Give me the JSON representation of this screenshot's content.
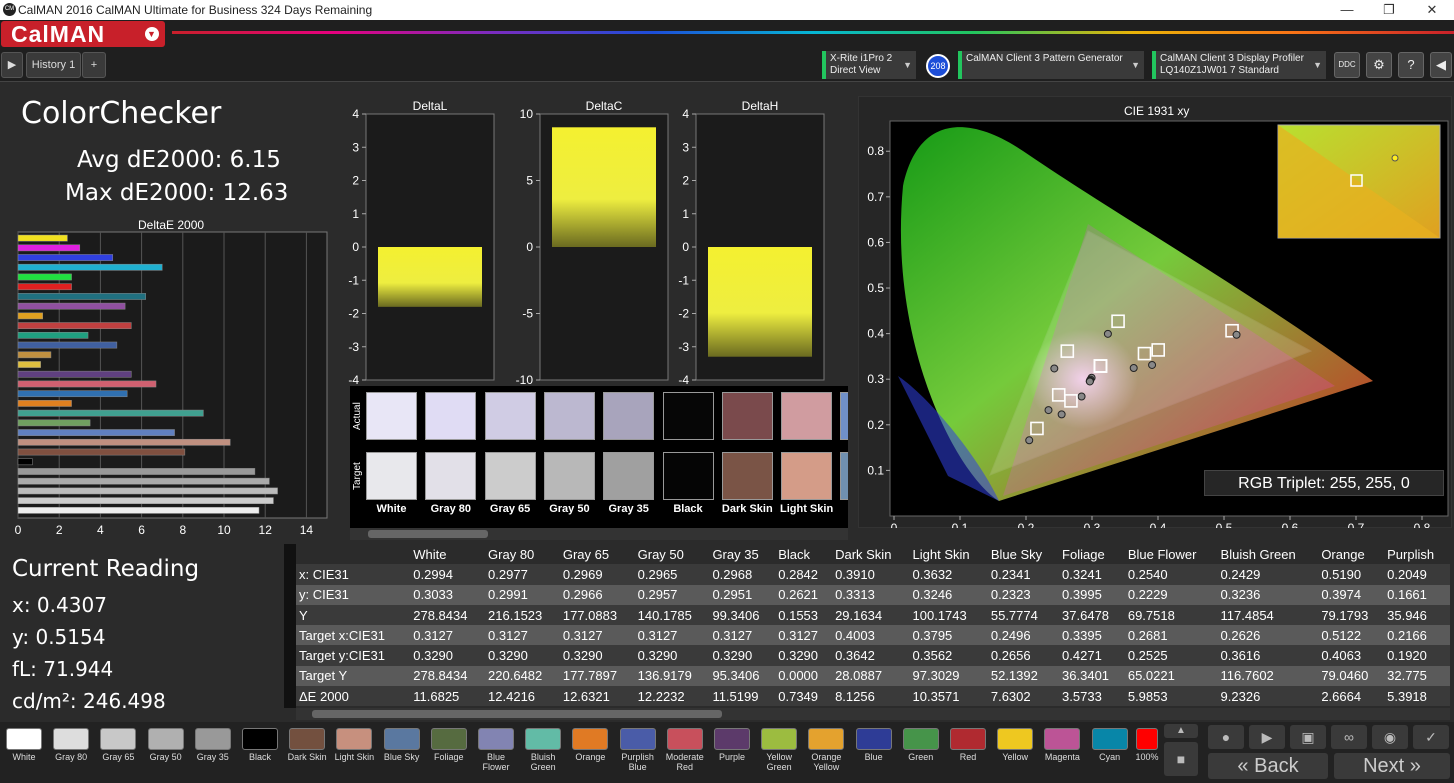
{
  "window": {
    "title": "CalMAN 2016 CalMAN Ultimate for Business 324 Days Remaining",
    "logo": "CM"
  },
  "brand": {
    "name": "CalMAN"
  },
  "toolbar": {
    "history_tab": "History 1",
    "add_tab": "+",
    "meter": {
      "line1": "X-Rite i1Pro 2",
      "line2": "Direct View",
      "badge": "208"
    },
    "pattern": {
      "line1": "CalMAN Client 3 Pattern Generator"
    },
    "display": {
      "line1": "CalMAN Client 3 Display Profiler",
      "line2": "LQ140Z1JW01 7 Standard"
    }
  },
  "colorchecker": {
    "title": "ColorChecker",
    "avg": "Avg dE2000: 6.15",
    "max": "Max dE2000: 12.63",
    "deltae_title": "DeltaE 2000"
  },
  "deltae_chart": {
    "xticks": [
      "0",
      "2",
      "4",
      "6",
      "8",
      "10",
      "12",
      "14"
    ],
    "bars": [
      {
        "v": 2.4,
        "c": "#f0e020"
      },
      {
        "v": 3.0,
        "c": "#e020e0"
      },
      {
        "v": 4.6,
        "c": "#3040e0"
      },
      {
        "v": 7.0,
        "c": "#20b0d0"
      },
      {
        "v": 2.6,
        "c": "#20e040"
      },
      {
        "v": 2.6,
        "c": "#e02020"
      },
      {
        "v": 6.2,
        "c": "#207080"
      },
      {
        "v": 5.2,
        "c": "#9050a0"
      },
      {
        "v": 1.2,
        "c": "#e0a020"
      },
      {
        "v": 5.5,
        "c": "#c04040"
      },
      {
        "v": 3.4,
        "c": "#20a080"
      },
      {
        "v": 4.8,
        "c": "#4060a0"
      },
      {
        "v": 1.6,
        "c": "#c09040"
      },
      {
        "v": 1.1,
        "c": "#e0c040"
      },
      {
        "v": 5.5,
        "c": "#604080"
      },
      {
        "v": 6.7,
        "c": "#d06070"
      },
      {
        "v": 5.3,
        "c": "#3070b0"
      },
      {
        "v": 2.6,
        "c": "#e08020"
      },
      {
        "v": 9.0,
        "c": "#40a090"
      },
      {
        "v": 3.5,
        "c": "#70a060"
      },
      {
        "v": 7.6,
        "c": "#6080c0"
      },
      {
        "v": 10.3,
        "c": "#c09080"
      },
      {
        "v": 8.1,
        "c": "#805040"
      },
      {
        "v": 0.7,
        "c": "#000000"
      },
      {
        "v": 11.5,
        "c": "#999999"
      },
      {
        "v": 12.2,
        "c": "#aaaaaa"
      },
      {
        "v": 12.6,
        "c": "#bbbbbb"
      },
      {
        "v": 12.4,
        "c": "#cccccc"
      },
      {
        "v": 11.7,
        "c": "#eeeeee"
      }
    ]
  },
  "delta_charts": [
    {
      "title": "DeltaL",
      "ticks": [
        "4",
        "3",
        "2",
        "1",
        "0",
        "-1",
        "-2",
        "-3",
        "-4"
      ],
      "value": -1.8,
      "range": [
        -4,
        4
      ]
    },
    {
      "title": "DeltaC",
      "ticks": [
        "10",
        "5",
        "0",
        "-5",
        "-10"
      ],
      "value": 9.0,
      "range": [
        -10,
        10
      ]
    },
    {
      "title": "DeltaH",
      "ticks": [
        "4",
        "3",
        "2",
        "1",
        "0",
        "-1",
        "-2",
        "-3",
        "-4"
      ],
      "value": -3.3,
      "range": [
        -4,
        4
      ]
    }
  ],
  "swatch_strip": {
    "actual_label": "Actual",
    "target_label": "Target",
    "items": [
      {
        "name": "White",
        "actual": "#e8e6f6",
        "target": "#e8e8ec"
      },
      {
        "name": "Gray 80",
        "actual": "#e0dcf4",
        "target": "#e2e0e8"
      },
      {
        "name": "Gray 65",
        "actual": "#d0cce4",
        "target": "#cccccc"
      },
      {
        "name": "Gray 50",
        "actual": "#bcb8d0",
        "target": "#b8b8b8"
      },
      {
        "name": "Gray 35",
        "actual": "#a8a4bc",
        "target": "#a0a0a0"
      },
      {
        "name": "Black",
        "actual": "#060606",
        "target": "#050505"
      },
      {
        "name": "Dark Skin",
        "actual": "#7a4a4c",
        "target": "#7a5446"
      },
      {
        "name": "Light Skin",
        "actual": "#d09ca0",
        "target": "#d49c88"
      },
      {
        "name": "B",
        "actual": "#7090c8",
        "target": "#7090b0"
      }
    ]
  },
  "cie": {
    "title": "CIE 1931 xy",
    "xticks": [
      "0",
      "0.1",
      "0.2",
      "0.3",
      "0.4",
      "0.5",
      "0.6",
      "0.7",
      "0.8"
    ],
    "yticks": [
      "0.8",
      "0.7",
      "0.6",
      "0.5",
      "0.4",
      "0.3",
      "0.2",
      "0.1"
    ],
    "rgb_triplet": "RGB Triplet: 255, 255, 0"
  },
  "current": {
    "title": "Current Reading",
    "x": "x: 0.4307",
    "y": "y: 0.5154",
    "fl": "fL: 71.944",
    "cdm": "cd/m²: 246.498"
  },
  "table": {
    "columns": [
      "",
      "White",
      "Gray 80",
      "Gray 65",
      "Gray 50",
      "Gray 35",
      "Black",
      "Dark Skin",
      "Light Skin",
      "Blue Sky",
      "Foliage",
      "Blue Flower",
      "Bluish Green",
      "Orange",
      "Purplish"
    ],
    "rows": [
      [
        "x: CIE31",
        "0.2994",
        "0.2977",
        "0.2969",
        "0.2965",
        "0.2968",
        "0.2842",
        "0.3910",
        "0.3632",
        "0.2341",
        "0.3241",
        "0.2540",
        "0.2429",
        "0.5190",
        "0.2049"
      ],
      [
        "y: CIE31",
        "0.3033",
        "0.2991",
        "0.2966",
        "0.2957",
        "0.2951",
        "0.2621",
        "0.3313",
        "0.3246",
        "0.2323",
        "0.3995",
        "0.2229",
        "0.3236",
        "0.3974",
        "0.1661"
      ],
      [
        "Y",
        "278.8434",
        "216.1523",
        "177.0883",
        "140.1785",
        "99.3406",
        "0.1553",
        "29.1634",
        "100.1743",
        "55.7774",
        "37.6478",
        "69.7518",
        "117.4854",
        "79.1793",
        "35.946"
      ],
      [
        "Target x:CIE31",
        "0.3127",
        "0.3127",
        "0.3127",
        "0.3127",
        "0.3127",
        "0.3127",
        "0.4003",
        "0.3795",
        "0.2496",
        "0.3395",
        "0.2681",
        "0.2626",
        "0.5122",
        "0.2166"
      ],
      [
        "Target y:CIE31",
        "0.3290",
        "0.3290",
        "0.3290",
        "0.3290",
        "0.3290",
        "0.3290",
        "0.3642",
        "0.3562",
        "0.2656",
        "0.4271",
        "0.2525",
        "0.3616",
        "0.4063",
        "0.1920"
      ],
      [
        "Target Y",
        "278.8434",
        "220.6482",
        "177.7897",
        "136.9179",
        "95.3406",
        "0.0000",
        "28.0887",
        "97.3029",
        "52.1392",
        "36.3401",
        "65.0221",
        "116.7602",
        "79.0460",
        "32.775"
      ],
      [
        "ΔE 2000",
        "11.6825",
        "12.4216",
        "12.6321",
        "12.2232",
        "11.5199",
        "0.7349",
        "8.1256",
        "10.3571",
        "7.6302",
        "3.5733",
        "5.9853",
        "9.2326",
        "2.6664",
        "5.3918"
      ]
    ]
  },
  "bottom_swatches": [
    {
      "label": "White",
      "color": "#ffffff"
    },
    {
      "label": "Gray 80",
      "color": "#dddddd"
    },
    {
      "label": "Gray 65",
      "color": "#c8c8c8"
    },
    {
      "label": "Gray 50",
      "color": "#b0b0b0"
    },
    {
      "label": "Gray 35",
      "color": "#999999"
    },
    {
      "label": "Black",
      "color": "#000000"
    },
    {
      "label": "Dark Skin",
      "color": "#73503f"
    },
    {
      "label": "Light Skin",
      "color": "#c7907e"
    },
    {
      "label": "Blue Sky",
      "color": "#5a78a0"
    },
    {
      "label": "Foliage",
      "color": "#566b40"
    },
    {
      "label": "Blue Flower",
      "color": "#8284b2"
    },
    {
      "label": "Bluish Green",
      "color": "#62bba6"
    },
    {
      "label": "Orange",
      "color": "#e07a24"
    },
    {
      "label": "Purplish Blue",
      "color": "#4a5ca8"
    },
    {
      "label": "Moderate Red",
      "color": "#c8505c"
    },
    {
      "label": "Purple",
      "color": "#5c3a6a"
    },
    {
      "label": "Yellow Green",
      "color": "#9cbc40"
    },
    {
      "label": "Orange Yellow",
      "color": "#e4a22e"
    },
    {
      "label": "Blue",
      "color": "#2e3c96"
    },
    {
      "label": "Green",
      "color": "#46944a"
    },
    {
      "label": "Red",
      "color": "#b02a30"
    },
    {
      "label": "Yellow",
      "color": "#eec820"
    },
    {
      "label": "Magenta",
      "color": "#bc5496"
    },
    {
      "label": "Cyan",
      "color": "#0886a8"
    },
    {
      "label": "100%",
      "color": "#ff0000"
    }
  ],
  "nav": {
    "back": "Back",
    "next": "Next"
  }
}
